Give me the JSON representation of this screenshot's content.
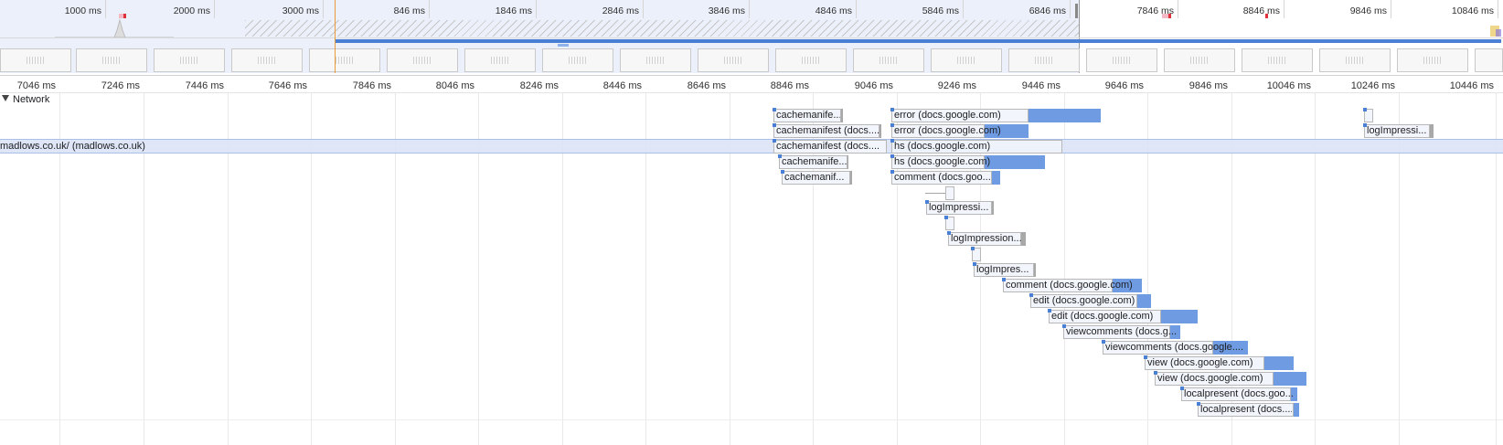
{
  "overview": {
    "ticks": [
      "1000 ms",
      "2000 ms",
      "3000 ms",
      "846 ms",
      "1846 ms",
      "2846 ms",
      "3846 ms",
      "4846 ms",
      "5846 ms",
      "6846 ms",
      "7846 ms",
      "8846 ms",
      "9846 ms",
      "10846 ms"
    ]
  },
  "timeline": {
    "ticks": [
      "7046 ms",
      "7246 ms",
      "7446 ms",
      "7646 ms",
      "7846 ms",
      "8046 ms",
      "8246 ms",
      "8446 ms",
      "8646 ms",
      "8846 ms",
      "9046 ms",
      "9246 ms",
      "9446 ms",
      "9646 ms",
      "9846 ms",
      "10046 ms",
      "10246 ms",
      "10446 ms"
    ]
  },
  "network": {
    "label": "Network",
    "selected_row_label": "madlows.co.uk/ (madlows.co.uk)",
    "requests": [
      {
        "label": "cachemanife..."
      },
      {
        "label": "cachemanifest (docs...."
      },
      {
        "label": "cachemanifest (docs...."
      },
      {
        "label": "cachemanife..."
      },
      {
        "label": "cachemanif..."
      },
      {
        "label": "error (docs.google.com)"
      },
      {
        "label": "error (docs.google.com)"
      },
      {
        "label": "hs (docs.google.com)"
      },
      {
        "label": "hs (docs.google.com)"
      },
      {
        "label": "comment (docs.goo..."
      },
      {
        "label": ""
      },
      {
        "label": "logImpressi..."
      },
      {
        "label": ""
      },
      {
        "label": "logImpression..."
      },
      {
        "label": ""
      },
      {
        "label": "logImpres..."
      },
      {
        "label": "comment (docs.google.com)"
      },
      {
        "label": "edit (docs.google.com)"
      },
      {
        "label": "edit (docs.google.com)"
      },
      {
        "label": "viewcomments (docs.g..."
      },
      {
        "label": "viewcomments (docs.google...."
      },
      {
        "label": "view (docs.google.com)"
      },
      {
        "label": "view (docs.google.com)"
      },
      {
        "label": "localpresent (docs.goo..."
      },
      {
        "label": "localpresent (docs...."
      },
      {
        "label": ""
      },
      {
        "label": "logImpressi..."
      }
    ]
  },
  "colors": {
    "download": "#6f9be3",
    "download_grey": "#a8a8a8",
    "selection": "#dae3f6",
    "cursor": "#ea9a37"
  }
}
